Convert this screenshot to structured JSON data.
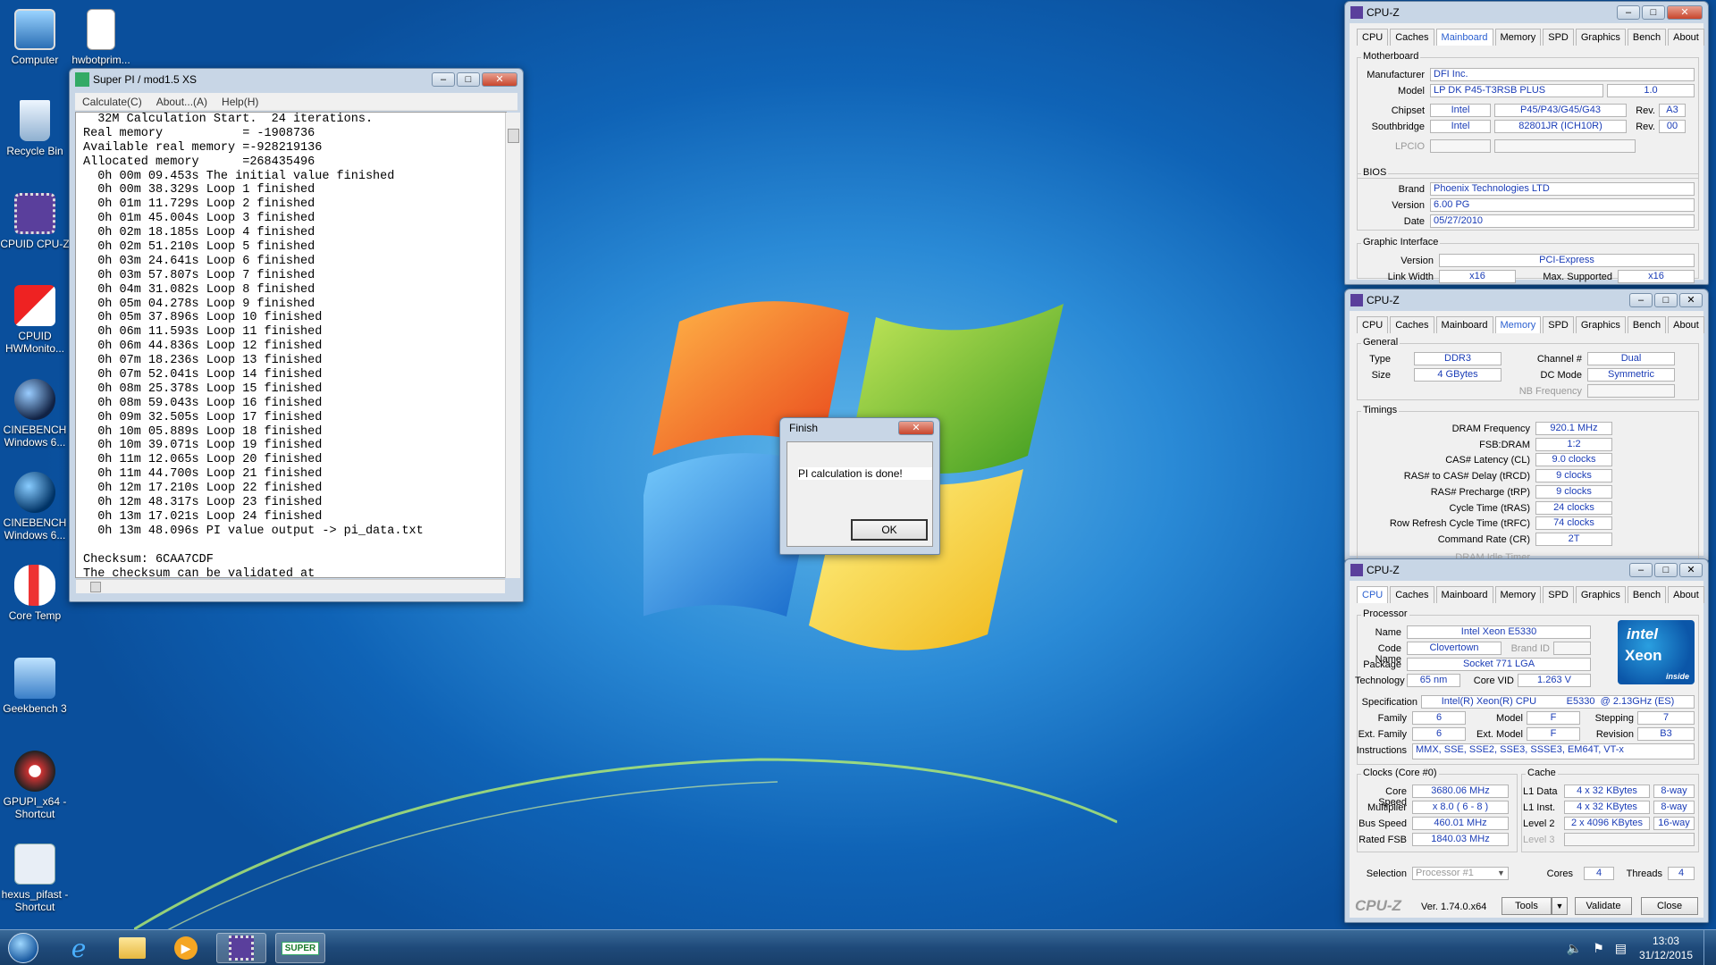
{
  "desktop": {
    "icons": [
      {
        "label": "Computer"
      },
      {
        "label": "hwbotprim..."
      },
      {
        "label": "Recycle Bin"
      },
      {
        "label": "CPUID CPU-Z"
      },
      {
        "label": "CPUID HWMonito..."
      },
      {
        "label": "CINEBENCH Windows 6..."
      },
      {
        "label": "CINEBENCH Windows 6..."
      },
      {
        "label": "Core Temp"
      },
      {
        "label": "Geekbench 3"
      },
      {
        "label": "GPUPI_x64 - Shortcut"
      },
      {
        "label": "hexus_pifast - Shortcut"
      }
    ]
  },
  "superpi": {
    "title": "Super PI / mod1.5 XS",
    "menu": [
      "Calculate(C)",
      "About...(A)",
      "Help(H)"
    ],
    "lines": [
      "  32M Calculation Start.  24 iterations.",
      "Real memory           = -1908736",
      "Available real memory =-928219136",
      "Allocated memory      =268435496",
      "  0h 00m 09.453s The initial value finished",
      "  0h 00m 38.329s Loop 1 finished",
      "  0h 01m 11.729s Loop 2 finished",
      "  0h 01m 45.004s Loop 3 finished",
      "  0h 02m 18.185s Loop 4 finished",
      "  0h 02m 51.210s Loop 5 finished",
      "  0h 03m 24.641s Loop 6 finished",
      "  0h 03m 57.807s Loop 7 finished",
      "  0h 04m 31.082s Loop 8 finished",
      "  0h 05m 04.278s Loop 9 finished",
      "  0h 05m 37.896s Loop 10 finished",
      "  0h 06m 11.593s Loop 11 finished",
      "  0h 06m 44.836s Loop 12 finished",
      "  0h 07m 18.236s Loop 13 finished",
      "  0h 07m 52.041s Loop 14 finished",
      "  0h 08m 25.378s Loop 15 finished",
      "  0h 08m 59.043s Loop 16 finished",
      "  0h 09m 32.505s Loop 17 finished",
      "  0h 10m 05.889s Loop 18 finished",
      "  0h 10m 39.071s Loop 19 finished",
      "  0h 11m 12.065s Loop 20 finished",
      "  0h 11m 44.700s Loop 21 finished",
      "  0h 12m 17.210s Loop 22 finished",
      "  0h 12m 48.317s Loop 23 finished",
      "  0h 13m 17.021s Loop 24 finished",
      "  0h 13m 48.096s PI value output -> pi_data.txt",
      "",
      "Checksum: 6CAA7CDF",
      "The checksum can be validated at"
    ]
  },
  "finish_dialog": {
    "title": "Finish",
    "message": "PI calculation is done!",
    "ok": "OK"
  },
  "cpuz_tabs": [
    "CPU",
    "Caches",
    "Mainboard",
    "Memory",
    "SPD",
    "Graphics",
    "Bench",
    "About"
  ],
  "cpuz_mainboard": {
    "title": "CPU-Z",
    "active_tab": "Mainboard",
    "motherboard_group": "Motherboard",
    "manufacturer_label": "Manufacturer",
    "manufacturer": "DFI Inc.",
    "model_label": "Model",
    "model": "LP DK P45-T3RSB PLUS",
    "model_rev": "1.0",
    "chipset_label": "Chipset",
    "chipset_vendor": "Intel",
    "chipset": "P45/P43/G45/G43",
    "chipset_rev_label": "Rev.",
    "chipset_rev": "A3",
    "southbridge_label": "Southbridge",
    "southbridge_vendor": "Intel",
    "southbridge": "82801JR (ICH10R)",
    "southbridge_rev_label": "Rev.",
    "southbridge_rev": "00",
    "lpcio_label": "LPCIO",
    "bios_group": "BIOS",
    "brand_label": "Brand",
    "brand": "Phoenix Technologies LTD",
    "version_label": "Version",
    "version": "6.00 PG",
    "date_label": "Date",
    "date": "05/27/2010",
    "gi_group": "Graphic Interface",
    "gi_version_label": "Version",
    "gi_version": "PCI-Express",
    "link_width_label": "Link Width",
    "link_width": "x16",
    "max_supported_label": "Max. Supported",
    "max_supported": "x16"
  },
  "cpuz_memory": {
    "title": "CPU-Z",
    "active_tab": "Memory",
    "general_group": "General",
    "type_label": "Type",
    "type": "DDR3",
    "size_label": "Size",
    "size": "4 GBytes",
    "channel_label": "Channel #",
    "channel": "Dual",
    "dcmode_label": "DC Mode",
    "dcmode": "Symmetric",
    "nbfreq_label": "NB Frequency",
    "timings_group": "Timings",
    "timings": [
      {
        "label": "DRAM Frequency",
        "value": "920.1 MHz"
      },
      {
        "label": "FSB:DRAM",
        "value": "1:2"
      },
      {
        "label": "CAS# Latency (CL)",
        "value": "9.0 clocks"
      },
      {
        "label": "RAS# to CAS# Delay (tRCD)",
        "value": "9 clocks"
      },
      {
        "label": "RAS# Precharge (tRP)",
        "value": "9 clocks"
      },
      {
        "label": "Cycle Time (tRAS)",
        "value": "24 clocks"
      },
      {
        "label": "Row Refresh Cycle Time (tRFC)",
        "value": "74 clocks"
      },
      {
        "label": "Command Rate (CR)",
        "value": "2T"
      }
    ],
    "idle_timer_label": "DRAM Idle Timer"
  },
  "cpuz_cpu": {
    "title": "CPU-Z",
    "active_tab": "CPU",
    "processor_group": "Processor",
    "name_label": "Name",
    "name": "Intel Xeon E5330",
    "codename_label": "Code Name",
    "codename": "Clovertown",
    "brandid_label": "Brand ID",
    "package_label": "Package",
    "package": "Socket 771 LGA",
    "technology_label": "Technology",
    "technology": "65 nm",
    "corevid_label": "Core VID",
    "corevid": "1.263 V",
    "spec_label": "Specification",
    "spec": "Intel(R) Xeon(R) CPU           E5330  @ 2.13GHz (ES)",
    "family_label": "Family",
    "family": "6",
    "model_label": "Model",
    "model": "F",
    "stepping_label": "Stepping",
    "stepping": "7",
    "extfamily_label": "Ext. Family",
    "extfamily": "6",
    "extmodel_label": "Ext. Model",
    "extmodel": "F",
    "revision_label": "Revision",
    "revision": "B3",
    "instructions_label": "Instructions",
    "instructions": "MMX, SSE, SSE2, SSE3, SSSE3, EM64T, VT-x",
    "logo_brand": "intel",
    "logo_product": "Xeon",
    "logo_inside": "inside",
    "clocks_group": "Clocks (Core #0)",
    "corespeed_label": "Core Speed",
    "corespeed": "3680.06 MHz",
    "multiplier_label": "Multiplier",
    "multiplier": "x 8.0 ( 6 - 8 )",
    "busspeed_label": "Bus Speed",
    "busspeed": "460.01 MHz",
    "ratedfsb_label": "Rated FSB",
    "ratedfsb": "1840.03 MHz",
    "cache_group": "Cache",
    "cache": [
      {
        "label": "L1 Data",
        "size": "4 x 32 KBytes",
        "way": "8-way"
      },
      {
        "label": "L1 Inst.",
        "size": "4 x 32 KBytes",
        "way": "8-way"
      },
      {
        "label": "Level 2",
        "size": "2 x 4096 KBytes",
        "way": "16-way"
      }
    ],
    "level3_label": "Level 3",
    "selection_label": "Selection",
    "selection": "Processor #1",
    "cores_label": "Cores",
    "cores": "4",
    "threads_label": "Threads",
    "threads": "4",
    "footer_logo": "CPU-Z",
    "version": "Ver. 1.74.0.x64",
    "tools": "Tools",
    "validate": "Validate",
    "close": "Close"
  },
  "taskbar": {
    "time": "13:03",
    "date": "31/12/2015",
    "superpi_label": "SUPER"
  },
  "colors": {
    "accent": "#2a5fd0",
    "value_text": "#1a3cb6",
    "desktop": "#1e7ad0"
  }
}
